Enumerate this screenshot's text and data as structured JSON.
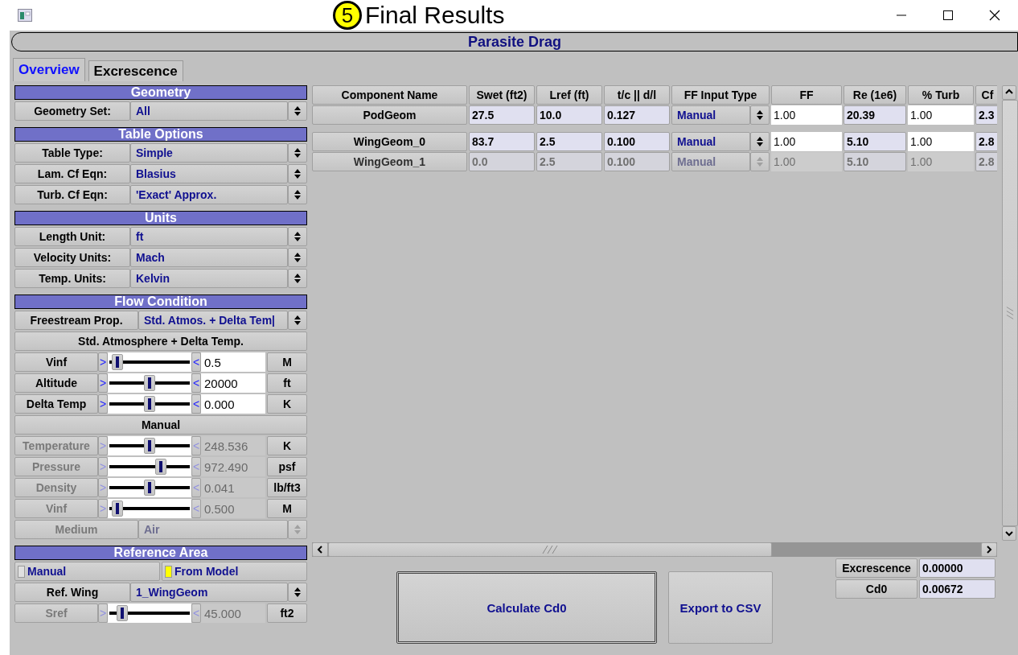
{
  "window": {
    "annotation": {
      "number": "5",
      "text": "Final Results"
    }
  },
  "header": {
    "title": "Parasite Drag"
  },
  "tabs": [
    {
      "label": "Overview",
      "selected": true
    },
    {
      "label": "Excrescence",
      "selected": false
    }
  ],
  "sections": [
    {
      "title": "Geometry",
      "rows": [
        {
          "kind": "select",
          "label": "Geometry Set:",
          "value": "All",
          "disabled": false
        }
      ]
    },
    {
      "title": "Table Options",
      "rows": [
        {
          "kind": "select",
          "label": "Table Type:",
          "value": "Simple",
          "disabled": false
        },
        {
          "kind": "select",
          "label": "Lam. Cf Eqn:",
          "value": "Blasius",
          "disabled": false
        },
        {
          "kind": "select",
          "label": "Turb. Cf Eqn:",
          "value": "'Exact' Approx.",
          "disabled": false
        }
      ]
    },
    {
      "title": "Units",
      "rows": [
        {
          "kind": "select",
          "label": "Length Unit:",
          "value": "ft",
          "disabled": false
        },
        {
          "kind": "select",
          "label": "Velocity Units:",
          "value": "Mach",
          "disabled": false
        },
        {
          "kind": "select",
          "label": "Temp. Units:",
          "value": "Kelvin",
          "disabled": false
        }
      ]
    },
    {
      "title": "Flow Condition",
      "rows": [
        {
          "kind": "select",
          "label": "Freestream Prop.",
          "value": "Std. Atmos. + Delta Tem|",
          "disabled": false,
          "wide": true
        },
        {
          "kind": "heading",
          "label": "Std. Atmosphere + Delta Temp."
        },
        {
          "kind": "slider",
          "label": "Vinf",
          "left_arrow": ">",
          "right_arrow": "<",
          "level": 0.03,
          "value": "0.5",
          "unit": "M",
          "disabled": false
        },
        {
          "kind": "slider",
          "label": "Altitude",
          "left_arrow": ">",
          "right_arrow": "<",
          "level": 0.5,
          "value": "20000",
          "unit": "ft",
          "disabled": false
        },
        {
          "kind": "slider",
          "label": "Delta Temp",
          "left_arrow": ">",
          "right_arrow": "<",
          "level": 0.5,
          "value": "0.000",
          "unit": "K",
          "disabled": false
        },
        {
          "kind": "heading",
          "label": "Manual"
        },
        {
          "kind": "slider",
          "label": "Temperature",
          "left_arrow": ">",
          "right_arrow": "<",
          "level": 0.5,
          "value": "248.536",
          "unit": "K",
          "disabled": true
        },
        {
          "kind": "slider",
          "label": "Pressure",
          "left_arrow": ">",
          "right_arrow": "<",
          "level": 0.66,
          "value": "972.490",
          "unit": "psf",
          "disabled": true
        },
        {
          "kind": "slider",
          "label": "Density",
          "left_arrow": ">",
          "right_arrow": "<",
          "level": 0.5,
          "value": "0.041",
          "unit": "lb/ft3",
          "disabled": true
        },
        {
          "kind": "slider",
          "label": "Vinf",
          "left_arrow": ">",
          "right_arrow": "<",
          "level": 0.03,
          "value": "0.500",
          "unit": "M",
          "disabled": true
        },
        {
          "kind": "select",
          "label": "Medium",
          "value": "Air",
          "disabled": true,
          "wide": true
        }
      ]
    },
    {
      "title": "Reference Area",
      "rows": [
        {
          "kind": "radio",
          "options": [
            {
              "label": "Manual",
              "selected": false
            },
            {
              "label": "From Model",
              "selected": true
            }
          ]
        },
        {
          "kind": "select",
          "label": "Ref. Wing",
          "value": "1_WingGeom",
          "disabled": false
        },
        {
          "kind": "slider",
          "label": "Sref",
          "left_arrow": ">",
          "right_arrow": "<",
          "level": 0.1,
          "value": "45.000",
          "unit": "ft2",
          "disabled": true
        }
      ]
    }
  ],
  "table": {
    "columns": [
      {
        "label": "Component Name",
        "kind": "name"
      },
      {
        "label": "Swet (ft2)",
        "kind": "computed"
      },
      {
        "label": "Lref (ft)",
        "kind": "computed"
      },
      {
        "label": "t/c || d/l",
        "kind": "computed"
      },
      {
        "label": "FF Input Type",
        "kind": "select"
      },
      {
        "label": "FF",
        "kind": "input"
      },
      {
        "label": "Re (1e6)",
        "kind": "computed"
      },
      {
        "label": "% Turb",
        "kind": "input"
      },
      {
        "label": "Cf",
        "kind": "computed"
      }
    ],
    "row_groups": [
      [
        {
          "cells": [
            "PodGeom",
            "27.5",
            "10.0",
            "0.127",
            "Manual",
            "1.00",
            "20.39",
            "1.00",
            "2.3"
          ],
          "disabled": false
        }
      ],
      [
        {
          "cells": [
            "WingGeom_0",
            "83.7",
            "2.5",
            "0.100",
            "Manual",
            "1.00",
            "5.10",
            "1.00",
            "2.8"
          ],
          "disabled": false
        },
        {
          "cells": [
            "WingGeom_1",
            "0.0",
            "2.5",
            "0.100",
            "Manual",
            "1.00",
            "5.10",
            "1.00",
            "2.8"
          ],
          "disabled": true
        }
      ]
    ]
  },
  "actions": [
    {
      "label": "Calculate Cd0",
      "focused": true
    },
    {
      "label": "Export to CSV",
      "focused": false
    }
  ],
  "results": [
    {
      "label": "Excrescence",
      "value": "0.00000"
    },
    {
      "label": "Cd0",
      "value": "0.00672"
    }
  ]
}
